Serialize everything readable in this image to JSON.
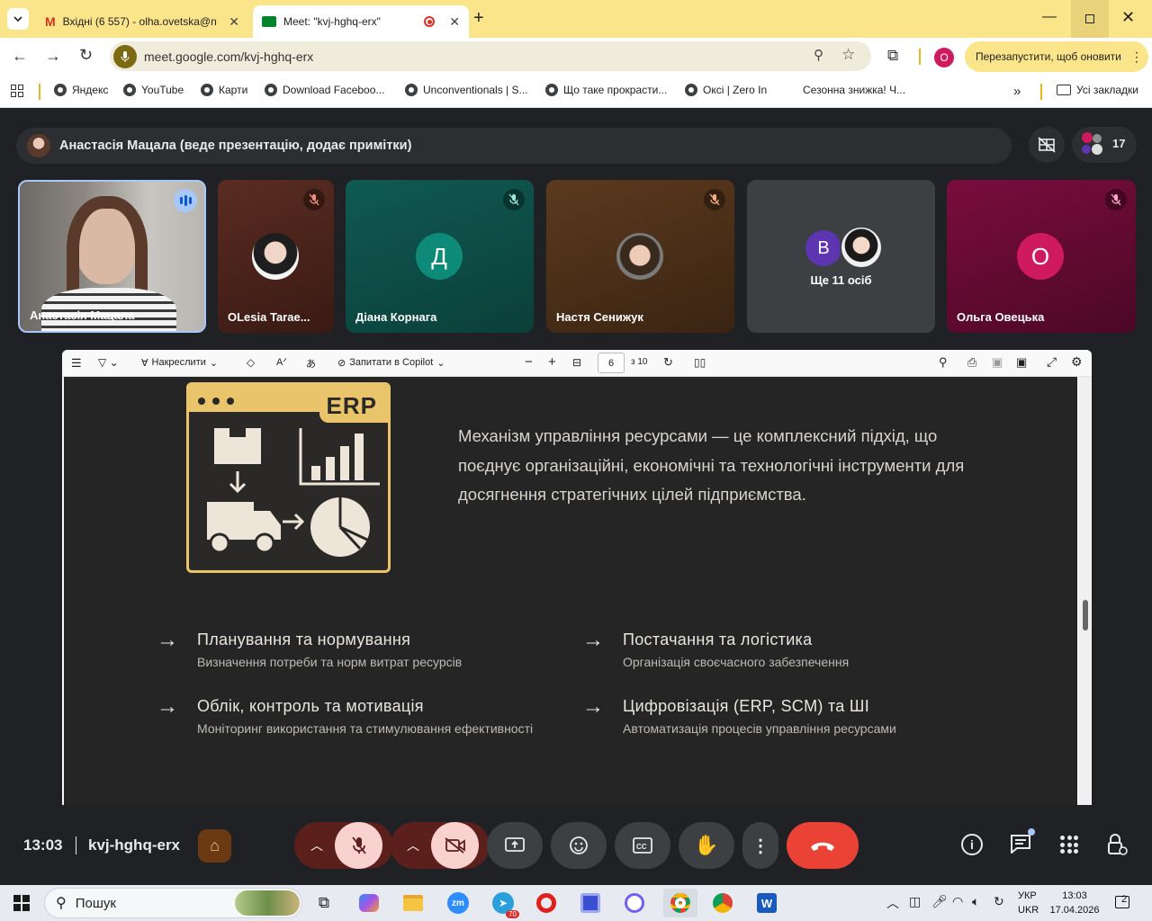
{
  "browser": {
    "tabs": [
      {
        "title": "Вхідні (6 557) - olha.ovetska@n"
      },
      {
        "title": "Meet: \"kvj-hghq-erx\""
      }
    ],
    "url": "meet.google.com/kvj-hghq-erx",
    "profile_initial": "О",
    "update_button": "Перезапустити, щоб оновити",
    "bookmarks": [
      "Яндекс",
      "YouTube",
      "Карти",
      "Download Faceboo...",
      "Unconventionals | S...",
      "Що таке прокрасти...",
      "Оксі | Zero In",
      "Сезонна знижка! Ч..."
    ],
    "all_bookmarks": "Усі закладки"
  },
  "meet": {
    "presenter_bar": "Анастасія Мацала (веде презентацію, додає примітки)",
    "participant_count": "17",
    "tiles": [
      {
        "name": "Анастасія Мацала"
      },
      {
        "name": "OLesia Tarae..."
      },
      {
        "name": "Діана Корнага",
        "initial": "Д"
      },
      {
        "name": "Настя Сенижук"
      },
      {
        "name": "Ще 11 осіб",
        "initial": "B"
      },
      {
        "name": "Ольга Овецька",
        "initial": "О"
      }
    ],
    "time": "13:03",
    "meeting_code": "kvj-hghq-erx"
  },
  "pdf": {
    "toolbar": {
      "draw": "Накреслити",
      "copilot": "Запитати в Copilot",
      "page": "6",
      "of": "з 10"
    },
    "slide": {
      "badge": "ERP",
      "description": [
        "Механізм управління ресурсами — це комплексний підхід, що",
        "поєднує організаційні, економічні та технологічні інструменти для",
        "досягнення стратегічних цілей підприємства."
      ],
      "features": [
        {
          "title": "Планування та нормування",
          "sub": "Визначення потреби та норм витрат ресурсів"
        },
        {
          "title": "Постачання та логістика",
          "sub": "Організація своєчасного забезпечення"
        },
        {
          "title": "Облік, контроль та мотивація",
          "sub": "Моніторинг використання та стимулювання ефективності"
        },
        {
          "title": "Цифровізація (ERP, SCM) та ШІ",
          "sub": "Автоматизація процесів управління ресурсами"
        }
      ]
    }
  },
  "taskbar": {
    "search": "Пошук",
    "telegram_badge": "70",
    "lang_top": "УКР",
    "lang_bottom": "UKR",
    "clock_time": "13:03",
    "clock_date": "17.04.2026",
    "notif_count": "2"
  },
  "colors": {
    "accent_red": "#ea4335",
    "erp_yellow": "#e9c46a",
    "mic_off_bg": "#f9d2d0",
    "ctrl_dark_red": "#5b1f1c"
  }
}
